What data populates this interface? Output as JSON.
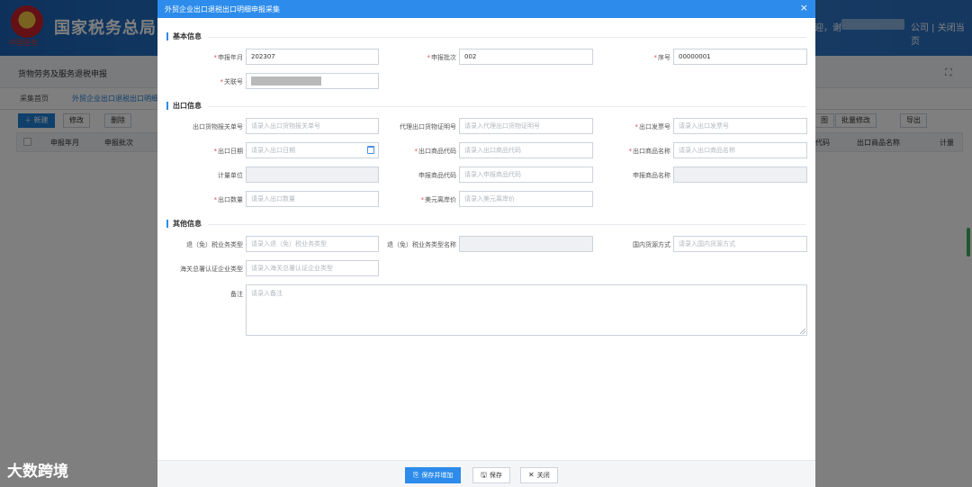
{
  "background": {
    "emblem_text": "中国税务",
    "site_title": "国家税务总局",
    "header_greeting": "迎，谢",
    "header_links": "公司 | 关闭当页",
    "page_subtitle": "货物劳务及服务退税申报",
    "expand_icon": "⛶",
    "tabs": [
      "采集首页",
      "外贸企业出口退税出口明细"
    ],
    "toolbar": {
      "new": "＋ 新建",
      "edit": "修改",
      "delete": "删除",
      "right_partial": "图",
      "batch_edit": "批量修改",
      "export": "导出"
    },
    "table_headers": {
      "h1": "申报年月",
      "h2": "申报批次",
      "h3": "代码",
      "h4": "出口商品名称",
      "h5": "计量"
    },
    "watermark": "大数跨境"
  },
  "modal": {
    "title": "外贸企业出口退税出口明细申报采集",
    "close_icon": "×",
    "sections": {
      "basic": "基本信息",
      "export": "出口信息",
      "other": "其他信息"
    },
    "fields": {
      "declare_month": {
        "label": "申报年月",
        "value": "202307"
      },
      "declare_batch": {
        "label": "申报批次",
        "value": "002"
      },
      "serial_no": {
        "label": "序号",
        "value": "00000001"
      },
      "link_no": {
        "label": "关联号",
        "value": ""
      },
      "customs_decl_no": {
        "label": "出口货物报关单号",
        "placeholder": "请录入出口货物报关单号"
      },
      "agency_cert_no": {
        "label": "代理出口货物证明号",
        "placeholder": "请录入代理出口货物证明号"
      },
      "invoice_no": {
        "label": "出口发票号",
        "placeholder": "请录入出口发票号"
      },
      "export_date": {
        "label": "出口日期",
        "placeholder": "请录入出口日期"
      },
      "goods_code": {
        "label": "出口商品代码",
        "placeholder": "请录入出口商品代码"
      },
      "goods_name": {
        "label": "出口商品名称",
        "placeholder": "请录入出口商品名称"
      },
      "unit": {
        "label": "计量单位"
      },
      "decl_goods_code": {
        "label": "申报商品代码",
        "placeholder": "请录入申报商品代码"
      },
      "decl_goods_name": {
        "label": "申报商品名称"
      },
      "export_qty": {
        "label": "出口数量",
        "placeholder": "请录入出口数量"
      },
      "usd_fob": {
        "label": "美元离岸价",
        "placeholder": "请录入美元离岸价"
      },
      "refund_type": {
        "label": "退（免）税业务类型",
        "placeholder": "请录入退（免）税业务类型"
      },
      "refund_type_name": {
        "label": "退（免）税业务类型名称"
      },
      "domestic_source": {
        "label": "国内货源方式",
        "placeholder": "请录入国内货源方式"
      },
      "customs_cert_type": {
        "label": "海关总署认证企业类型",
        "placeholder": "请录入海关总署认证企业类型"
      },
      "remark": {
        "label": "备注",
        "placeholder": "请录入备注"
      }
    },
    "footer": {
      "save_add": "保存并增加",
      "save": "保存",
      "close": "关闭"
    }
  },
  "colors": {
    "primary": "#2d8ceb",
    "required": "#e24a4a",
    "header_bg": "#1b63b6"
  }
}
